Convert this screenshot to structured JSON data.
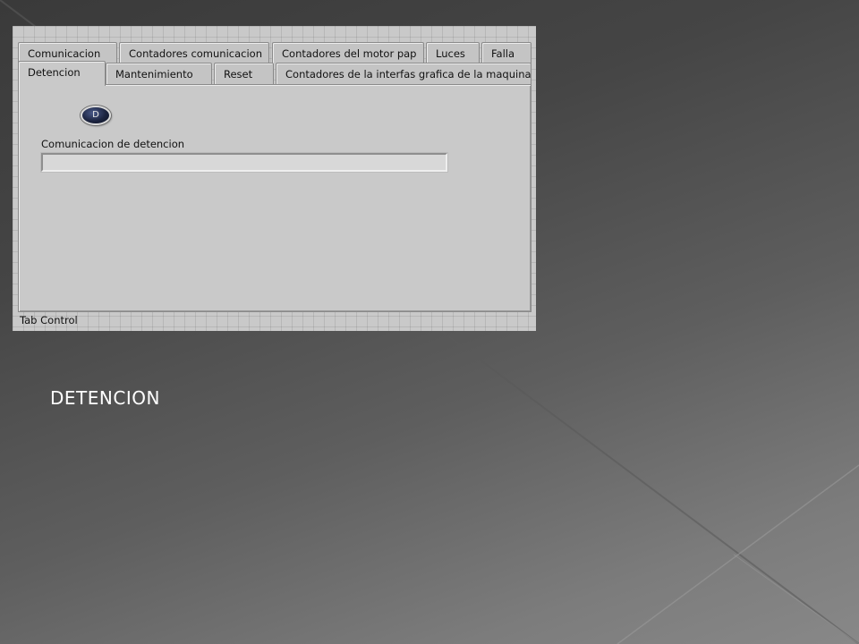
{
  "tab_control": {
    "caption": "Tab Control",
    "back_row": [
      {
        "label": "Comunicacion"
      },
      {
        "label": "Contadores comunicacion"
      },
      {
        "label": "Contadores del motor pap"
      },
      {
        "label": "Luces"
      },
      {
        "label": "Falla"
      }
    ],
    "front_row": [
      {
        "label": "Detencion",
        "active": true
      },
      {
        "label": "Mantenimiento"
      },
      {
        "label": "Reset"
      },
      {
        "label": "Contadores de la interfas grafica de la maquina"
      }
    ],
    "active_tab": "Detencion"
  },
  "detencion_page": {
    "led_button_label": "D",
    "string_label": "Comunicacion de detencion",
    "string_value": ""
  },
  "slide": {
    "caption": "DETENCION"
  },
  "colors": {
    "panel_bg": "#c9c9c9",
    "led_fill": "#1c2440",
    "slide_text": "#ffffff"
  }
}
